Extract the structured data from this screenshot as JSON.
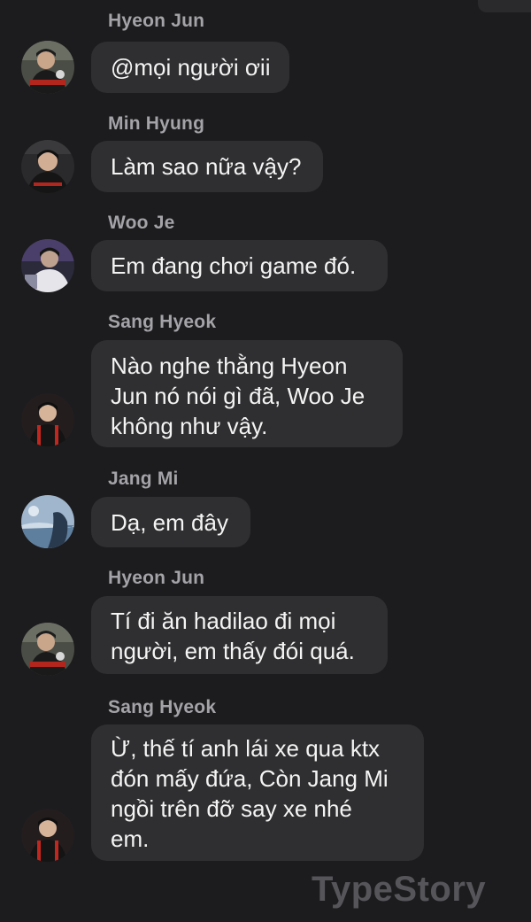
{
  "messages": [
    {
      "sender": "Hyeon Jun",
      "avatar": "hyeon-jun-avatar",
      "lines": [
        "@mọi người ơii"
      ]
    },
    {
      "sender": "Min Hyung",
      "avatar": "min-hyung-avatar",
      "lines": [
        "Làm sao nữa vậy?"
      ]
    },
    {
      "sender": "Woo Je",
      "avatar": "woo-je-avatar",
      "lines": [
        "Em đang chơi game đó."
      ]
    },
    {
      "sender": "Sang Hyeok",
      "avatar": "sang-hyeok-avatar",
      "lines": [
        "Nào nghe thằng Hyeon",
        "Jun nó nói gì đã, Woo Je",
        "không như vậy."
      ]
    },
    {
      "sender": "Jang Mi",
      "avatar": "jang-mi-avatar",
      "lines": [
        "Dạ, em đây"
      ]
    },
    {
      "sender": "Hyeon Jun",
      "avatar": "hyeon-jun-avatar",
      "lines": [
        "Tí đi ăn hadilao đi mọi",
        "người, em thấy đói quá."
      ]
    },
    {
      "sender": "Sang Hyeok",
      "avatar": "sang-hyeok-avatar",
      "lines": [
        "Ừ, thế tí anh lái xe qua ktx",
        "đón mấy đứa, Còn Jang Mi",
        "ngồi trên đỡ say xe nhé",
        "em."
      ]
    }
  ],
  "watermark": "TypeStory",
  "colors": {
    "background": "#1c1c1e",
    "bubble": "#2f2f31",
    "sender": "#a3a3a8",
    "text": "#f4f4f4",
    "watermark": "#55555a"
  }
}
